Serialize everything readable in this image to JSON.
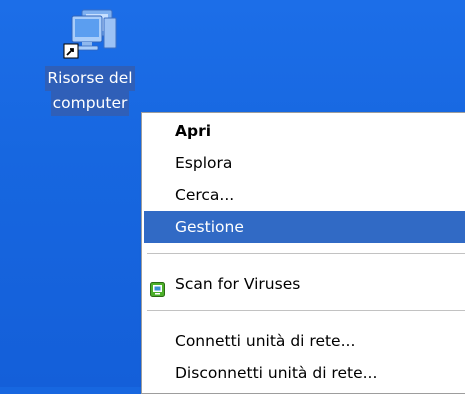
{
  "desktop": {
    "icon": {
      "name": "computer-icon",
      "label_line1": "Risorse del",
      "label_line2": "computer"
    }
  },
  "context_menu": {
    "items": [
      {
        "label": "Apri",
        "bold": true
      },
      {
        "label": "Esplora"
      },
      {
        "label": "Cerca..."
      },
      {
        "label": "Gestione",
        "selected": true
      },
      {
        "label": "Scan for Viruses",
        "icon": "antivirus-icon"
      },
      {
        "label": "Connetti unità di rete..."
      },
      {
        "label": "Disconnetti unità di rete..."
      }
    ]
  },
  "colors": {
    "desktop_blue": "#1767e0",
    "selection": "#316ac5",
    "label_highlight": "#2f5fb8"
  }
}
